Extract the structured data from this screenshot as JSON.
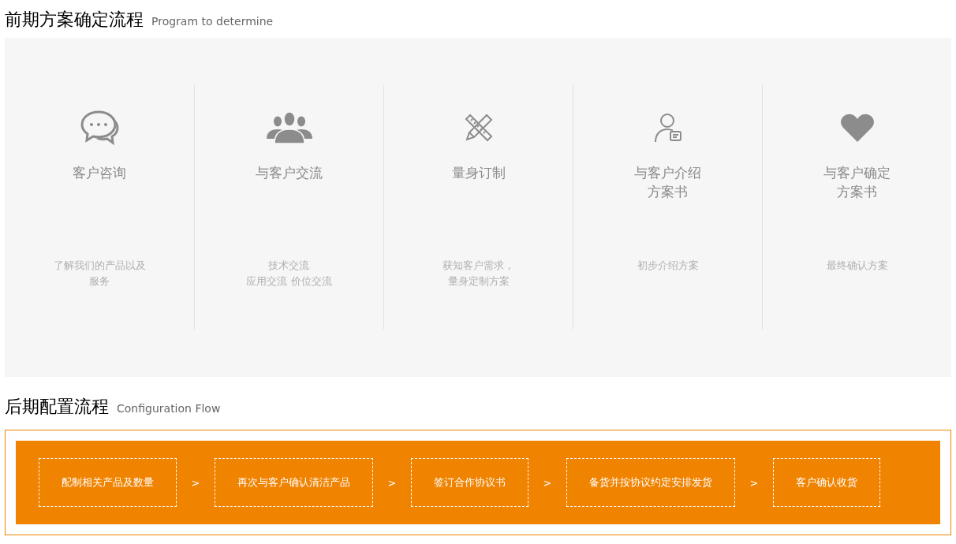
{
  "early_section": {
    "title": "前期方案确定流程",
    "subtitle": "Program to determine",
    "steps": [
      {
        "kind": "chat",
        "title": [
          "客户咨询"
        ],
        "description": [
          "了解我们的产品以及",
          "服务"
        ]
      },
      {
        "kind": "group",
        "title": [
          "与客户交流"
        ],
        "description": [
          "技术交流",
          "应用交流 价位交流"
        ]
      },
      {
        "kind": "ruler-pencil",
        "title": [
          "量身订制"
        ],
        "description": [
          "获知客户需求，",
          "量身定制方案"
        ]
      },
      {
        "kind": "user-card",
        "title": [
          "与客户介绍",
          "方案书"
        ],
        "description": [
          "初步介绍方案"
        ]
      },
      {
        "kind": "heart",
        "title": [
          "与客户确定",
          "方案书"
        ],
        "description": [
          "最终确认方案"
        ]
      }
    ]
  },
  "late_section": {
    "title": "后期配置流程",
    "subtitle": "Configuration Flow",
    "steps": [
      {
        "label": "配制相关产品及数量",
        "separator": ">"
      },
      {
        "label": "再次与客户确认清洁产品",
        "separator": ">"
      },
      {
        "label": "签订合作协议书",
        "separator": ">"
      },
      {
        "label": "备货并按协议约定安排发货",
        "separator": ">"
      },
      {
        "label": "客户确认收货"
      }
    ]
  }
}
